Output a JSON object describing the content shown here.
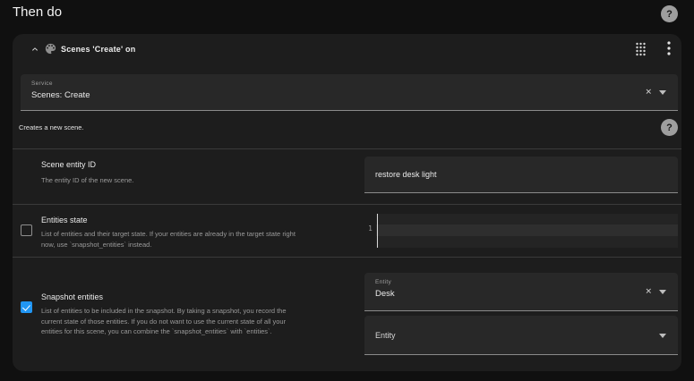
{
  "page": {
    "title": "Then do"
  },
  "icons": {
    "help": "?",
    "clear": "✕"
  },
  "colors": {
    "accent_blue": "#2196f3",
    "page_bg": "#101010",
    "card_bg": "#1d1d1d",
    "field_bg": "#282828"
  },
  "action_card": {
    "title": "Scenes 'Create' on",
    "service": {
      "label": "Service",
      "value": "Scenes: Create"
    },
    "service_description": "Creates a new scene.",
    "fields": {
      "scene_id": {
        "label": "Scene entity ID",
        "description": "The entity ID of the new scene.",
        "value": "restore desk light"
      },
      "entities_state": {
        "label": "Entities state",
        "description": "List of entities and their target state. If your entities are already in the target state right\nnow, use `snapshot_entities` instead.",
        "checked": false,
        "editor": {
          "line_number": "1"
        }
      },
      "snapshot_entities": {
        "label": "Snapshot entities",
        "description": "List of entities to be included in the snapshot. By taking a snapshot, you record the\ncurrent state of those entities. If you do not want to use the current state of all your\nentities for this scene, you can combine the `snapshot_entities` with `entities`.",
        "checked": true,
        "entity_picker": {
          "label": "Entity",
          "value": "Desk"
        },
        "entity_picker_secondary": {
          "placeholder": "Entity"
        }
      }
    }
  }
}
